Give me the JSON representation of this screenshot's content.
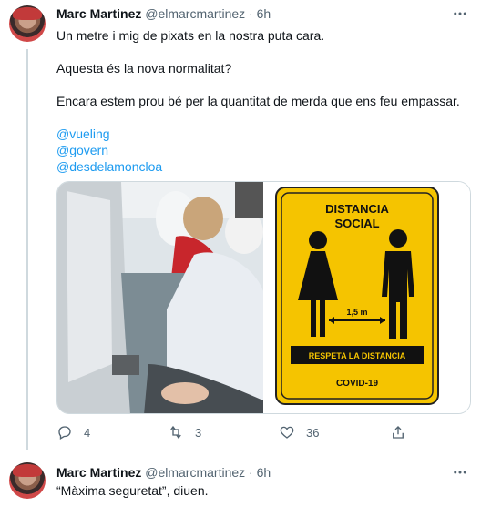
{
  "tweet1": {
    "name": "Marc Martinez",
    "handle": "@elmarcmartinez",
    "separator": "·",
    "time": "6h",
    "lines": [
      "Un metre i mig de pixats en la nostra puta cara.",
      "Aquesta és la nova normalitat?",
      "Encara estem prou bé per la quantitat de merda que ens feu empassar."
    ],
    "mentions": [
      "@vueling",
      "@govern",
      "@desdelamoncloa"
    ],
    "sign": {
      "title_line1": "DISTANCIA",
      "title_line2": "SOCIAL",
      "distance": "1,5 m",
      "banner": "RESPETA LA DISTANCIA",
      "footer": "COVID-19"
    },
    "actions": {
      "replies": "4",
      "retweets": "3",
      "likes": "36"
    }
  },
  "tweet2": {
    "name": "Marc Martinez",
    "handle": "@elmarcmartinez",
    "separator": "·",
    "time": "6h",
    "text": "“Màxima seguretat”, diuen."
  },
  "colors": {
    "link": "#1d9bf0",
    "sign_yellow": "#f5c400",
    "secondary_text": "#536471"
  }
}
